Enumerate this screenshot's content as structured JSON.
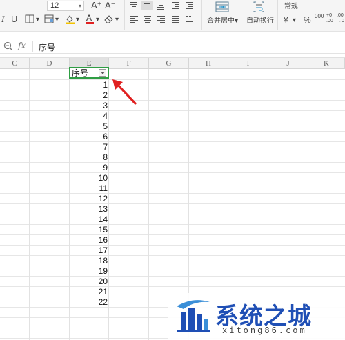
{
  "toolbar": {
    "font_size": "12",
    "grow_font_label": "A⁺",
    "shrink_font_label": "A⁻",
    "italic_label": "I",
    "underline_label": "U",
    "merge_center_label": "合并居中",
    "wrap_text_label": "自动换行",
    "number_format_label": "常规",
    "currency_label": "¥",
    "percent_label": "%",
    "thousands_label": "000",
    "increase_decimal_label": "+0 .00",
    "decrease_decimal_label": ".00 →0",
    "dropdown_glyph": "▾"
  },
  "formula_bar": {
    "fx_label": "fx",
    "value": "序号"
  },
  "columns": [
    "C",
    "D",
    "E",
    "F",
    "G",
    "H",
    "I",
    "J",
    "K"
  ],
  "active_column": "E",
  "header_cell": {
    "text": "序号"
  },
  "rows": [
    "1",
    "2",
    "3",
    "4",
    "5",
    "6",
    "7",
    "8",
    "9",
    "10",
    "11",
    "12",
    "13",
    "14",
    "15",
    "16",
    "17",
    "18",
    "19",
    "20",
    "21",
    "22"
  ],
  "colors": {
    "selection": "#2f9e44",
    "arrow": "#e02020",
    "watermark": "#1f4fb5"
  },
  "watermark": {
    "title": "系统之城",
    "url": "xitong86.com"
  }
}
